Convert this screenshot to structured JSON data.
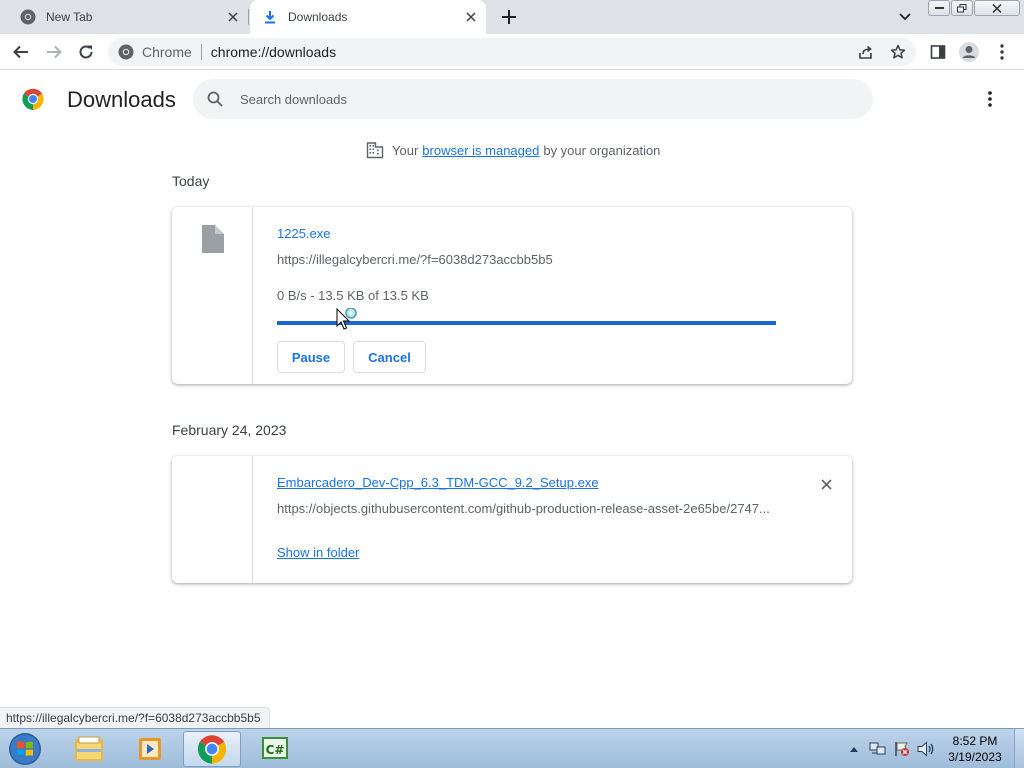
{
  "tabs": [
    {
      "title": "New Tab",
      "icon": "chrome-icon"
    },
    {
      "title": "Downloads",
      "icon": "download-icon"
    }
  ],
  "omnibox": {
    "chip": "Chrome",
    "url": "chrome://downloads"
  },
  "header": {
    "title": "Downloads",
    "search_placeholder": "Search downloads"
  },
  "managed_notice": {
    "prefix": "Your",
    "link": "browser is managed",
    "suffix": "by your organization"
  },
  "groups": [
    {
      "date": "Today",
      "item": {
        "filename": "1225.exe",
        "url": "https://illegalcybercri.me/?f=6038d273accbb5b5",
        "status": "0 B/s - 13.5 KB of 13.5 KB",
        "progress_percent": 100,
        "pause_label": "Pause",
        "cancel_label": "Cancel"
      }
    },
    {
      "date": "February 24, 2023",
      "item": {
        "filename": "Embarcadero_Dev-Cpp_6.3_TDM-GCC_9.2_Setup.exe",
        "url": "https://objects.githubusercontent.com/github-production-release-asset-2e65be/2747...",
        "show_in_folder": "Show in folder"
      }
    }
  ],
  "status_bubble": "https://illegalcybercri.me/?f=6038d273accbb5b5",
  "taskbar": {
    "apps": [
      "explorer-icon",
      "media-player-icon",
      "chrome-icon",
      "csharp-icon"
    ],
    "time": "8:52 PM",
    "date": "3/19/2023"
  },
  "colors": {
    "accent": "#1a73e8",
    "progress": "#1967d2",
    "tabstrip": "#dee1e6"
  }
}
